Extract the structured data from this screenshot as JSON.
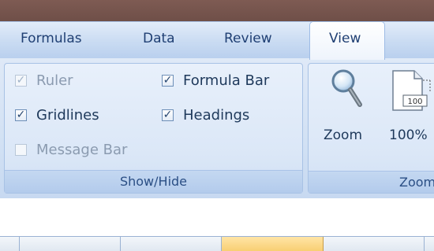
{
  "tabs": {
    "items": [
      "Formulas",
      "Data",
      "Review"
    ],
    "active": "View"
  },
  "show_hide": {
    "items": [
      {
        "label": "Ruler",
        "checked": true,
        "enabled": false
      },
      {
        "label": "Formula Bar",
        "checked": true,
        "enabled": true
      },
      {
        "label": "Gridlines",
        "checked": true,
        "enabled": true
      },
      {
        "label": "Headings",
        "checked": true,
        "enabled": true
      },
      {
        "label": "Message Bar",
        "checked": false,
        "enabled": false
      }
    ],
    "group_label": "Show/Hide"
  },
  "zoom_group": {
    "zoom_label": "Zoom",
    "zoom100_label": "100%",
    "zoom100_icon_text": "100",
    "group_label": "Zoom"
  },
  "colors": {
    "title_bar": "#7e5b53",
    "ribbon": "#d2e1f4",
    "text": "#1e395b",
    "selected_column": "#f8cf73"
  }
}
